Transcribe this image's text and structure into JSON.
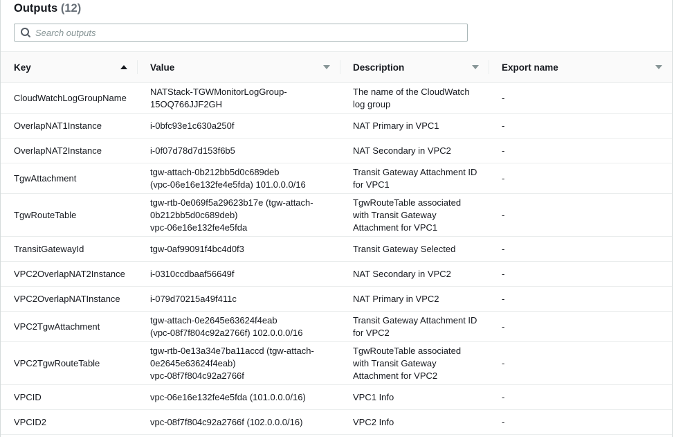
{
  "header": {
    "title": "Outputs",
    "count": "(12)"
  },
  "search": {
    "placeholder": "Search outputs",
    "value": ""
  },
  "columns": [
    {
      "label": "Key",
      "sort": "ascending"
    },
    {
      "label": "Value",
      "sort": "none"
    },
    {
      "label": "Description",
      "sort": "none"
    },
    {
      "label": "Export name",
      "sort": "none"
    }
  ],
  "rows": [
    {
      "key": "CloudWatchLogGroupName",
      "value": "NATStack-TGWMonitorLogGroup-\n15OQ766JJF2GH",
      "description": "The name of the CloudWatch\nlog group",
      "export": "-"
    },
    {
      "key": "OverlapNAT1Instance",
      "value": "i-0bfc93e1c630a250f",
      "description": "NAT Primary in VPC1",
      "export": "-"
    },
    {
      "key": "OverlapNAT2Instance",
      "value": "i-0f07d78d7d153f6b5",
      "description": "NAT Secondary in VPC2",
      "export": "-"
    },
    {
      "key": "TgwAttachment",
      "value": "tgw-attach-0b212bb5d0c689deb\n(vpc-06e16e132fe4e5fda) 101.0.0.0/16",
      "description": "Transit Gateway Attachment ID\nfor VPC1",
      "export": "-"
    },
    {
      "key": "TgwRouteTable",
      "value": "tgw-rtb-0e069f5a29623b17e (tgw-attach-\n0b212bb5d0c689deb)\nvpc-06e16e132fe4e5fda",
      "description": "TgwRouteTable associated\nwith Transit Gateway\nAttachment for VPC1",
      "export": "-"
    },
    {
      "key": "TransitGatewayId",
      "value": "tgw-0af99091f4bc4d0f3",
      "description": "Transit Gateway Selected",
      "export": "-"
    },
    {
      "key": "VPC2OverlapNAT2Instance",
      "value": "i-0310ccdbaaf56649f",
      "description": "NAT Secondary in VPC2",
      "export": "-"
    },
    {
      "key": "VPC2OverlapNATInstance",
      "value": "i-079d70215a49f411c",
      "description": "NAT Primary in VPC2",
      "export": "-"
    },
    {
      "key": "VPC2TgwAttachment",
      "value": "tgw-attach-0e2645e63624f4eab\n(vpc-08f7f804c92a2766f) 102.0.0.0/16",
      "description": "Transit Gateway Attachment ID\nfor VPC2",
      "export": "-"
    },
    {
      "key": "VPC2TgwRouteTable",
      "value": "tgw-rtb-0e13a34e7ba11accd (tgw-attach-\n0e2645e63624f4eab)\nvpc-08f7f804c92a2766f",
      "description": "TgwRouteTable associated\nwith Transit Gateway\nAttachment for VPC2",
      "export": "-"
    },
    {
      "key": "VPCID",
      "value": "vpc-06e16e132fe4e5fda (101.0.0.0/16)",
      "description": "VPC1 Info",
      "export": "-"
    },
    {
      "key": "VPCID2",
      "value": "vpc-08f7f804c92a2766f (102.0.0.0/16)",
      "description": "VPC2 Info",
      "export": "-"
    }
  ],
  "icons": {
    "search": "search-icon",
    "sort_ascending": "caret-up-icon",
    "sort_none": "caret-down-icon"
  },
  "colors": {
    "title": "#16191f",
    "count": "#687078",
    "border": "#eaeded",
    "header_bg": "#fafafa",
    "icon": "#545b64"
  }
}
